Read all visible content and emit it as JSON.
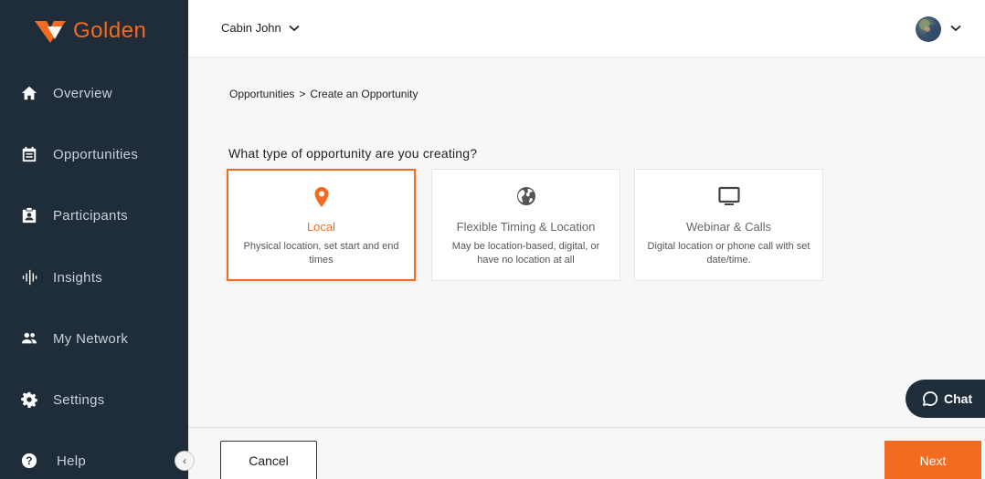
{
  "brand": {
    "name": "Golden",
    "accent_color": "#f26b21",
    "sidebar_color": "#1f2c39"
  },
  "sidebar": {
    "items": [
      {
        "label": "Overview",
        "icon": "home-icon"
      },
      {
        "label": "Opportunities",
        "icon": "calendar-icon"
      },
      {
        "label": "Participants",
        "icon": "id-badge-icon"
      },
      {
        "label": "Insights",
        "icon": "soundwave-icon"
      },
      {
        "label": "My Network",
        "icon": "people-icon"
      },
      {
        "label": "Settings",
        "icon": "gear-icon"
      },
      {
        "label": "Help",
        "icon": "help-icon"
      }
    ],
    "collapse_glyph": "‹"
  },
  "topbar": {
    "org_name": "Cabin John"
  },
  "breadcrumb": {
    "parent": "Opportunities",
    "separator": ">",
    "current": "Create an Opportunity"
  },
  "main": {
    "question": "What type of opportunity are you creating?",
    "cards": [
      {
        "title": "Local",
        "description": "Physical location, set start and end times",
        "icon": "location-pin-icon",
        "selected": true
      },
      {
        "title": "Flexible Timing & Location",
        "description": "May be location-based, digital, or have no location at all",
        "icon": "globe-icon",
        "selected": false
      },
      {
        "title": "Webinar & Calls",
        "description": "Digital location or phone call with set date/time.",
        "icon": "monitor-icon",
        "selected": false
      }
    ]
  },
  "chat": {
    "label": "Chat"
  },
  "footer": {
    "cancel_label": "Cancel",
    "next_label": "Next"
  }
}
